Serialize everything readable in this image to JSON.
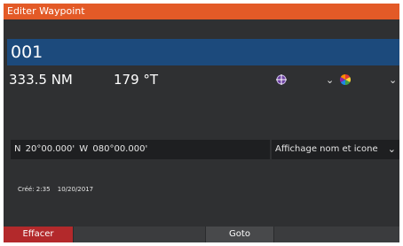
{
  "window": {
    "title": "Editer Waypoint"
  },
  "waypoint": {
    "name": "001",
    "distance": "333.5 NM",
    "bearing": "179 °T",
    "position": "N 20°00.000'   W 080°00.000'",
    "display_mode": "Affichage nom et icone",
    "created_label": "Créé: 2:35",
    "created_date": "10/20/2017"
  },
  "selectors": {
    "icon": {
      "icon_name": "waypoint-symbol-icon"
    },
    "color": {
      "icon_name": "color-wheel-icon"
    }
  },
  "buttons": {
    "delete": "Effacer",
    "goto": "Goto"
  },
  "colors": {
    "title_bar": "#e35a27",
    "name_field": "#1c4a7c",
    "delete_button": "#b3292b",
    "background": "#2f3032"
  }
}
